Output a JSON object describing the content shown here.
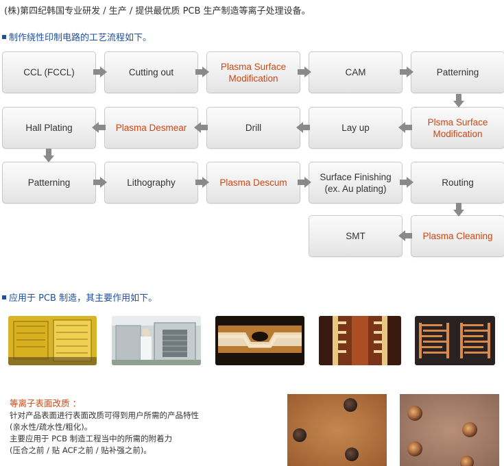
{
  "header": {
    "intro": "(株)第四纪韩国专业研发 / 生产 / 提供最优质 PCB 生产制造等离子处理设备。"
  },
  "process": {
    "title": "制作绕性印制电路的工艺流程如下。",
    "steps": {
      "s1": "CCL (FCCL)",
      "s2": "Cutting out",
      "s3": "Plasma Surface Modification",
      "s4": "CAM",
      "s5": "Patterning",
      "s6": "Plsma Surface Modification",
      "s7": "Lay up",
      "s8": "Drill",
      "s9": "Plasma Desmear",
      "s10": "Hall Plating",
      "s11": "Patterning",
      "s12": "Lithography",
      "s13": "Plasma Descum",
      "s14": "Surface Finishing (ex. Au plating)",
      "s15": "Routing",
      "s16": "Plasma Cleaning",
      "s17": "SMT"
    },
    "highlight_color": "#d04510",
    "arrow_color": "#8a8a8a"
  },
  "application": {
    "title": "应用于 PCB 制造，其主要作用如下。",
    "photos": [
      "yellow-flex-circuit-photo",
      "plasma-machine-operator-photo",
      "via-cross-section-photo",
      "trace-cross-section-photo",
      "comb-pattern-photo",
      "copper-surface-before-photo",
      "copper-surface-after-photo"
    ]
  },
  "description": {
    "title": "等离子表面改质 ：",
    "lines": [
      "针对产品表面进行表面改质可得到用户所需的产品特性",
      "(亲水性/疏水性/粗化)。",
      "主要应用于 PCB 制造工程当中的所需的附着力",
      "(压合之前 / 贴 ACF之前 / 贴补强之前)。"
    ]
  }
}
